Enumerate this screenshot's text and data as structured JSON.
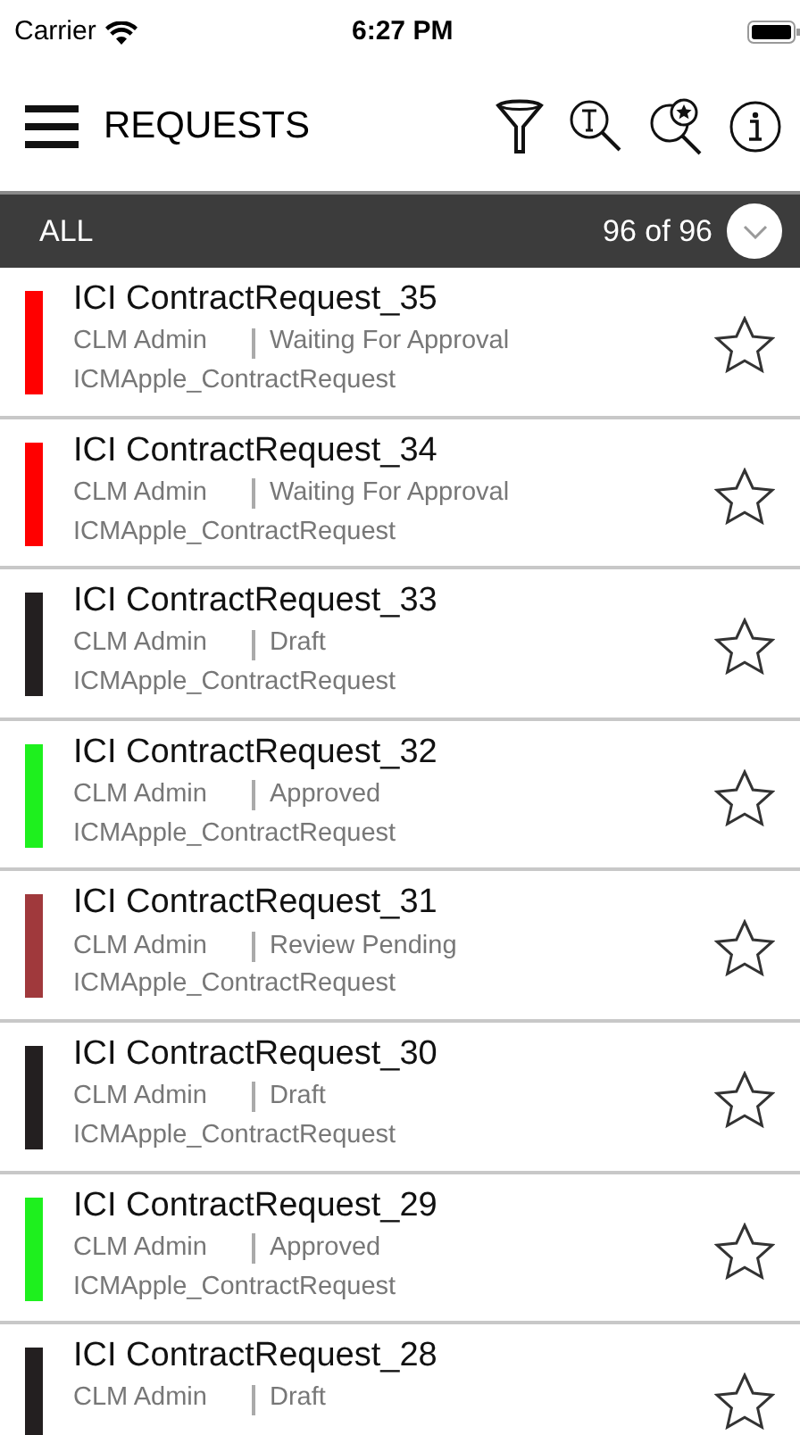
{
  "status_bar": {
    "carrier": "Carrier",
    "time": "6:27 PM"
  },
  "header": {
    "title": "REQUESTS"
  },
  "filter_bar": {
    "label": "ALL",
    "count": "96 of 96"
  },
  "requests": [
    {
      "title": "ICI ContractRequest_35",
      "owner": "CLM Admin",
      "status": "Waiting For Approval",
      "type": "ICMApple_ContractRequest",
      "color": "#ff0000",
      "starred": false
    },
    {
      "title": "ICI ContractRequest_34",
      "owner": "CLM Admin",
      "status": "Waiting For Approval",
      "type": "ICMApple_ContractRequest",
      "color": "#ff0000",
      "starred": false
    },
    {
      "title": "ICI ContractRequest_33",
      "owner": "CLM Admin",
      "status": "Draft",
      "type": "ICMApple_ContractRequest",
      "color": "#231f20",
      "starred": false
    },
    {
      "title": "ICI ContractRequest_32",
      "owner": "CLM Admin",
      "status": "Approved",
      "type": "ICMApple_ContractRequest",
      "color": "#1ef01e",
      "starred": false
    },
    {
      "title": "ICI ContractRequest_31",
      "owner": "CLM Admin",
      "status": "Review Pending",
      "type": "ICMApple_ContractRequest",
      "color": "#a0393c",
      "starred": false
    },
    {
      "title": "ICI ContractRequest_30",
      "owner": "CLM Admin",
      "status": "Draft",
      "type": "ICMApple_ContractRequest",
      "color": "#231f20",
      "starred": false
    },
    {
      "title": "ICI ContractRequest_29",
      "owner": "CLM Admin",
      "status": "Approved",
      "type": "ICMApple_ContractRequest",
      "color": "#1ef01e",
      "starred": false
    },
    {
      "title": "ICI ContractRequest_28",
      "owner": "CLM Admin",
      "status": "Draft",
      "color": "#231f20",
      "starred": false
    }
  ]
}
